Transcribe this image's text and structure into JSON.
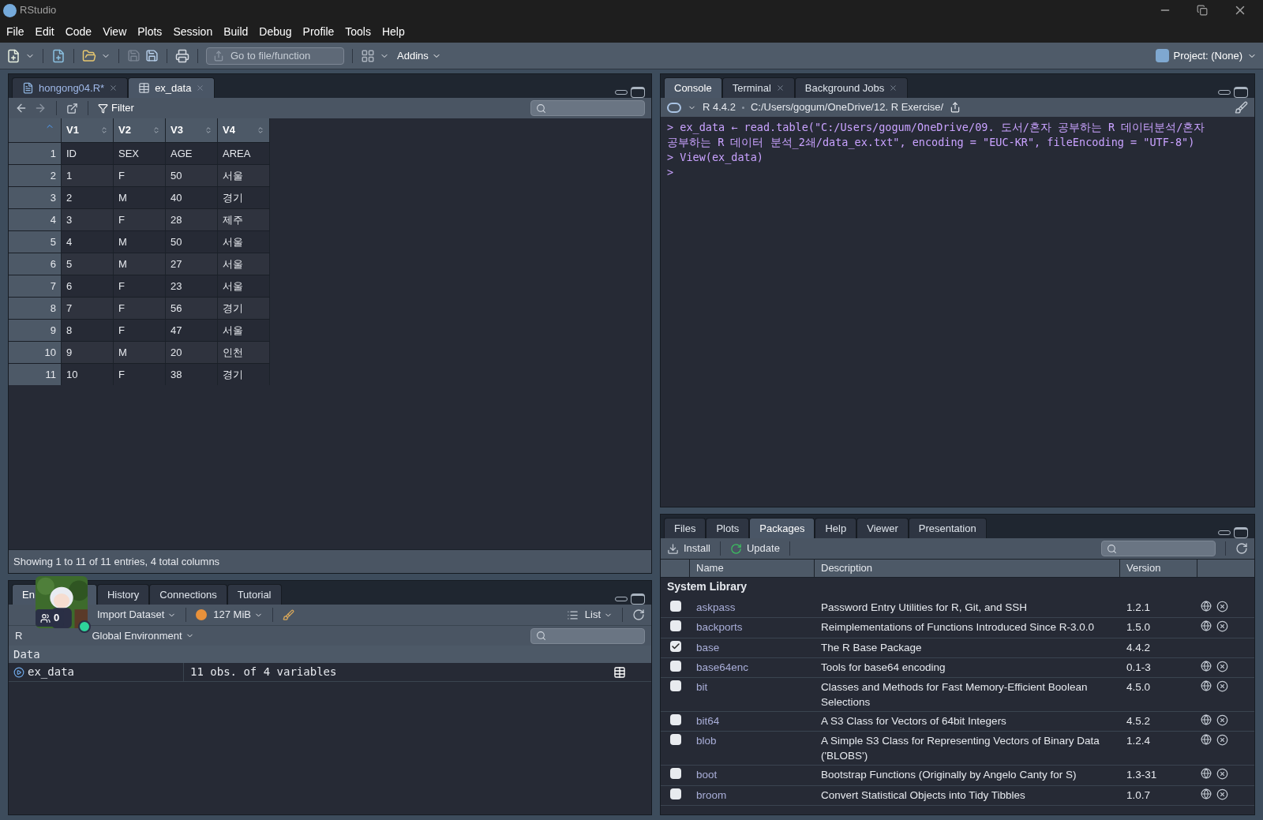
{
  "window": {
    "title": "RStudio"
  },
  "menu": [
    "File",
    "Edit",
    "Code",
    "View",
    "Plots",
    "Session",
    "Build",
    "Debug",
    "Profile",
    "Tools",
    "Help"
  ],
  "toolbar": {
    "goto_placeholder": "Go to file/function",
    "addins": "Addins",
    "project": "Project: (None)"
  },
  "source_pane": {
    "tabs": [
      {
        "label": "hongong04.R*",
        "selected": false,
        "kind": "script"
      },
      {
        "label": "ex_data",
        "selected": true,
        "kind": "data"
      }
    ],
    "filter": "Filter",
    "columns": [
      "V1",
      "V2",
      "V3",
      "V4"
    ],
    "rows": [
      {
        "n": "1",
        "cells": [
          "ID",
          "SEX",
          "AGE",
          "AREA"
        ]
      },
      {
        "n": "2",
        "cells": [
          "1",
          "F",
          "50",
          "서울"
        ]
      },
      {
        "n": "3",
        "cells": [
          "2",
          "M",
          "40",
          "경기"
        ]
      },
      {
        "n": "4",
        "cells": [
          "3",
          "F",
          "28",
          "제주"
        ]
      },
      {
        "n": "5",
        "cells": [
          "4",
          "M",
          "50",
          "서울"
        ]
      },
      {
        "n": "6",
        "cells": [
          "5",
          "M",
          "27",
          "서울"
        ]
      },
      {
        "n": "7",
        "cells": [
          "6",
          "F",
          "23",
          "서울"
        ]
      },
      {
        "n": "8",
        "cells": [
          "7",
          "F",
          "56",
          "경기"
        ]
      },
      {
        "n": "9",
        "cells": [
          "8",
          "F",
          "47",
          "서울"
        ]
      },
      {
        "n": "10",
        "cells": [
          "9",
          "M",
          "20",
          "인천"
        ]
      },
      {
        "n": "11",
        "cells": [
          "10",
          "F",
          "38",
          "경기"
        ]
      }
    ],
    "status": "Showing 1 to 11 of 11 entries, 4 total columns"
  },
  "environment_pane": {
    "tabs": [
      {
        "label": "En",
        "selected": true
      },
      {
        "label": "History",
        "selected": false
      },
      {
        "label": "Connections",
        "selected": false
      },
      {
        "label": "Tutorial",
        "selected": false
      }
    ],
    "import": "Import Dataset",
    "memory": "127 MiB",
    "view": "List",
    "language": "R",
    "scope": "Global Environment",
    "section": "Data",
    "items": [
      {
        "name": "ex_data",
        "value": "11 obs. of 4 variables"
      }
    ]
  },
  "overlay": {
    "count": "0"
  },
  "console_pane": {
    "tabs": [
      {
        "label": "Console",
        "selected": true,
        "closable": false
      },
      {
        "label": "Terminal",
        "selected": false,
        "closable": true
      },
      {
        "label": "Background Jobs",
        "selected": false,
        "closable": true
      }
    ],
    "version": "R 4.4.2",
    "path": "C:/Users/gogum/OneDrive/12. R Exercise/",
    "lines": [
      "> ex_data ← read.table(\"C:/Users/gogum/OneDrive/09. 도서/혼자 공부하는 R 데이터분석/혼자",
      "공부하는 R 데이터 분석_2쇄/data_ex.txt\", encoding = \"EUC-KR\", fileEncoding = \"UTF-8\")",
      "> View(ex_data)",
      ">"
    ]
  },
  "packages_pane": {
    "tabs": [
      {
        "label": "Files",
        "selected": false
      },
      {
        "label": "Plots",
        "selected": false
      },
      {
        "label": "Packages",
        "selected": true
      },
      {
        "label": "Help",
        "selected": false
      },
      {
        "label": "Viewer",
        "selected": false
      },
      {
        "label": "Presentation",
        "selected": false
      }
    ],
    "install": "Install",
    "update": "Update",
    "columns": [
      "Name",
      "Description",
      "Version"
    ],
    "section": "System Library",
    "packages": [
      {
        "name": "askpass",
        "description": "Password Entry Utilities for R, Git, and SSH",
        "version": "1.2.1",
        "checked": false,
        "actions": true
      },
      {
        "name": "backports",
        "description": "Reimplementations of Functions Introduced Since R-3.0.0",
        "version": "1.5.0",
        "checked": false,
        "actions": true
      },
      {
        "name": "base",
        "description": "The R Base Package",
        "version": "4.4.2",
        "checked": true,
        "actions": false
      },
      {
        "name": "base64enc",
        "description": "Tools for base64 encoding",
        "version": "0.1-3",
        "checked": false,
        "actions": true
      },
      {
        "name": "bit",
        "description": "Classes and Methods for Fast Memory-Efficient Boolean Selections",
        "version": "4.5.0",
        "checked": false,
        "actions": true
      },
      {
        "name": "bit64",
        "description": "A S3 Class for Vectors of 64bit Integers",
        "version": "4.5.2",
        "checked": false,
        "actions": true
      },
      {
        "name": "blob",
        "description": "A Simple S3 Class for Representing Vectors of Binary Data ('BLOBS')",
        "version": "1.2.4",
        "checked": false,
        "actions": true
      },
      {
        "name": "boot",
        "description": "Bootstrap Functions (Originally by Angelo Canty for S)",
        "version": "1.3-31",
        "checked": false,
        "actions": true
      },
      {
        "name": "broom",
        "description": "Convert Statistical Objects into Tidy Tibbles",
        "version": "1.0.7",
        "checked": false,
        "actions": true
      }
    ]
  }
}
